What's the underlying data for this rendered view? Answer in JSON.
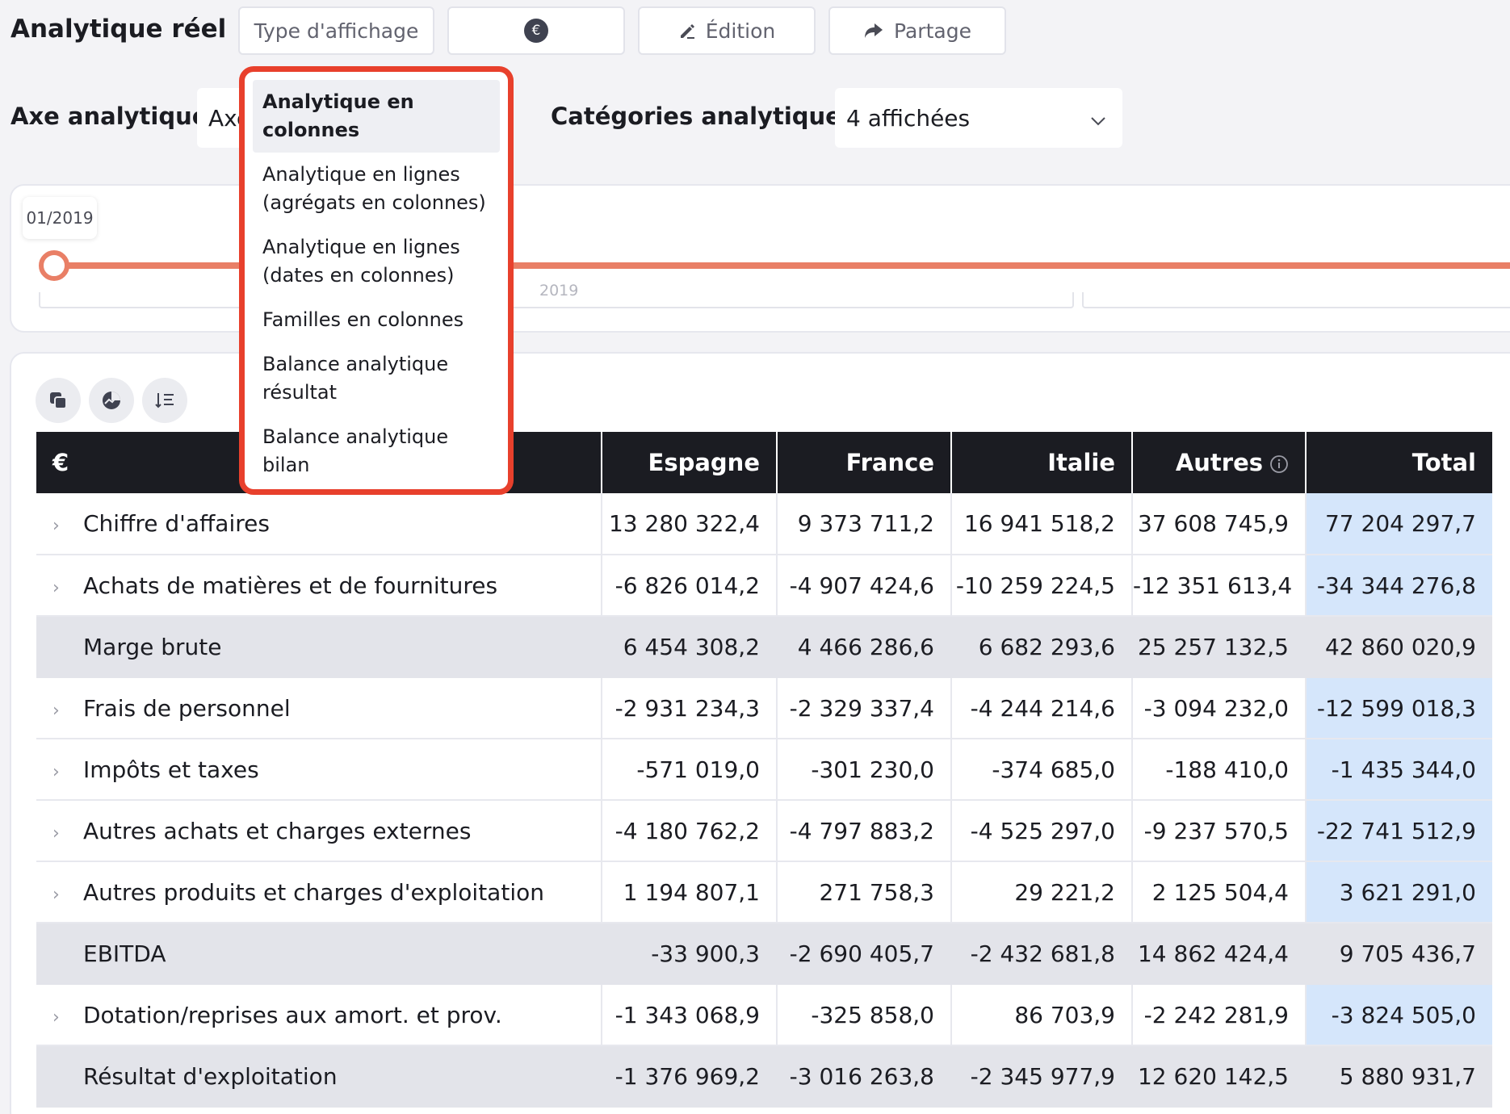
{
  "header": {
    "title": "Analytique réel",
    "type_button": "Type d'affichage",
    "currency_icon": "€",
    "edit_button": "Édition",
    "share_button": "Partage"
  },
  "filters": {
    "axis_label": "Axe analytique",
    "axis_value": "Axe",
    "categories_label": "Catégories analytiques",
    "categories_value": "4 affichées"
  },
  "timeline": {
    "start_date": "01/2019",
    "year_label": "2019"
  },
  "dropdown": {
    "items": [
      "Analytique en colonnes",
      "Analytique en lignes (agrégats en colonnes)",
      "Analytique en lignes (dates en colonnes)",
      "Familles en colonnes",
      "Balance analytique résultat",
      "Balance analytique bilan"
    ],
    "selected_index": 0
  },
  "table": {
    "currency_header": "€",
    "columns": [
      "Espagne",
      "France",
      "Italie",
      "Autres",
      "Total"
    ],
    "rows": [
      {
        "label": "Chiffre d'affaires",
        "expandable": true,
        "subtotal": false,
        "values": [
          "13 280 322,4",
          "9 373 711,2",
          "16 941 518,2",
          "37 608 745,9",
          "77 204 297,7"
        ]
      },
      {
        "label": "Achats de matières et de fournitures",
        "expandable": true,
        "subtotal": false,
        "values": [
          "-6 826 014,2",
          "-4 907 424,6",
          "-10 259 224,5",
          "-12 351 613,4",
          "-34 344 276,8"
        ]
      },
      {
        "label": "Marge brute",
        "expandable": false,
        "subtotal": true,
        "values": [
          "6 454 308,2",
          "4 466 286,6",
          "6 682 293,6",
          "25 257 132,5",
          "42 860 020,9"
        ]
      },
      {
        "label": "Frais de personnel",
        "expandable": true,
        "subtotal": false,
        "values": [
          "-2 931 234,3",
          "-2 329 337,4",
          "-4 244 214,6",
          "-3 094 232,0",
          "-12 599 018,3"
        ]
      },
      {
        "label": "Impôts et taxes",
        "expandable": true,
        "subtotal": false,
        "values": [
          "-571 019,0",
          "-301 230,0",
          "-374 685,0",
          "-188 410,0",
          "-1 435 344,0"
        ]
      },
      {
        "label": "Autres achats et charges externes",
        "expandable": true,
        "subtotal": false,
        "values": [
          "-4 180 762,2",
          "-4 797 883,2",
          "-4 525 297,0",
          "-9 237 570,5",
          "-22 741 512,9"
        ]
      },
      {
        "label": "Autres produits et charges d'exploitation",
        "expandable": true,
        "subtotal": false,
        "values": [
          "1 194 807,1",
          "271 758,3",
          "29 221,2",
          "2 125 504,4",
          "3 621 291,0"
        ]
      },
      {
        "label": "EBITDA",
        "expandable": false,
        "subtotal": true,
        "values": [
          "-33 900,3",
          "-2 690 405,7",
          "-2 432 681,8",
          "14 862 424,4",
          "9 705 436,7"
        ]
      },
      {
        "label": "Dotation/reprises aux amort. et prov.",
        "expandable": true,
        "subtotal": false,
        "values": [
          "-1 343 068,9",
          "-325 858,0",
          "86 703,9",
          "-2 242 281,9",
          "-3 824 505,0"
        ]
      },
      {
        "label": "Résultat d'exploitation",
        "expandable": false,
        "subtotal": true,
        "values": [
          "-1 376 969,2",
          "-3 016 263,8",
          "-2 345 977,9",
          "12 620 142,5",
          "5 880 931,7"
        ]
      }
    ]
  },
  "colors": {
    "accent": "#e97f66",
    "highlight_border": "#e8402c",
    "total_column": "#d5e6fb",
    "header_bg": "#1b1c22"
  }
}
